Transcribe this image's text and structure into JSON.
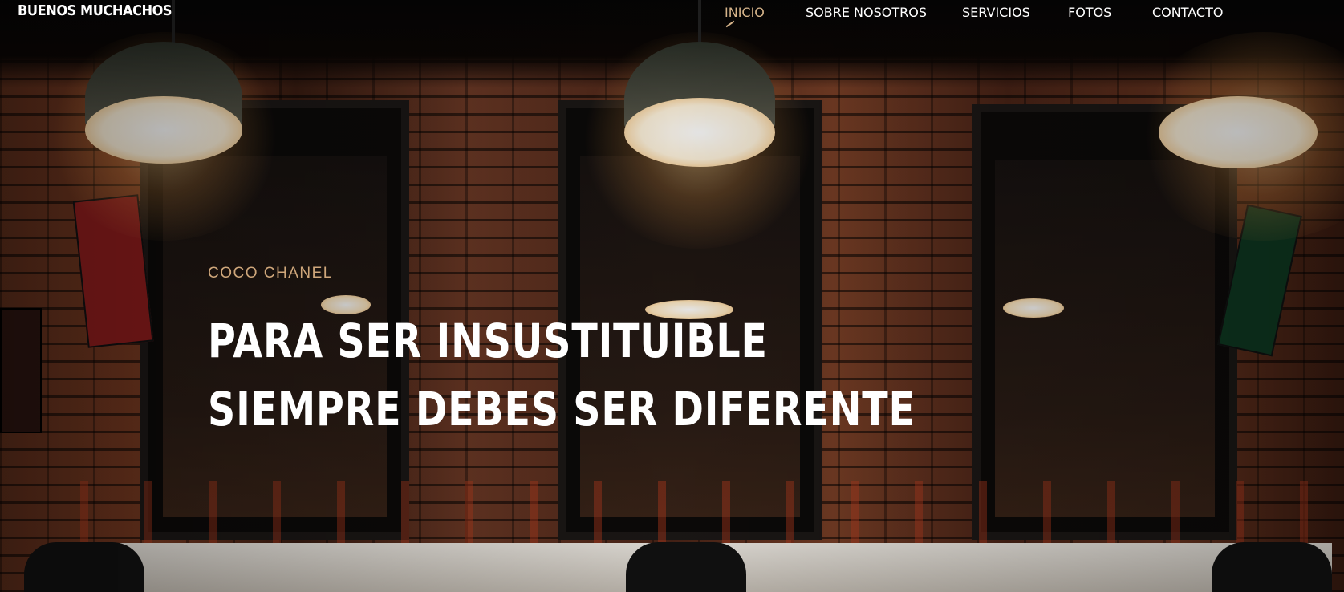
{
  "brand": {
    "name": "BUENOS MUCHACHOS"
  },
  "nav": {
    "items": [
      {
        "label": "INICIO",
        "active": true
      },
      {
        "label": "SOBRE NOSOTROS",
        "active": false
      },
      {
        "label": "SERVICIOS",
        "active": false
      },
      {
        "label": "FOTOS",
        "active": false
      },
      {
        "label": "CONTACTO",
        "active": false
      }
    ]
  },
  "hero": {
    "quote_author": "COCO CHANEL",
    "headline_line1": "PARA SER INSUSTITUIBLE",
    "headline_line2": "SIEMPRE DEBES SER DIFERENTE",
    "background_image": "barbershop-interior-photo"
  },
  "colors": {
    "accent": "#d6b48a",
    "nav_text": "#ffffff",
    "headline_text": "#ffffff",
    "quote_author_text": "#cfa77b"
  }
}
